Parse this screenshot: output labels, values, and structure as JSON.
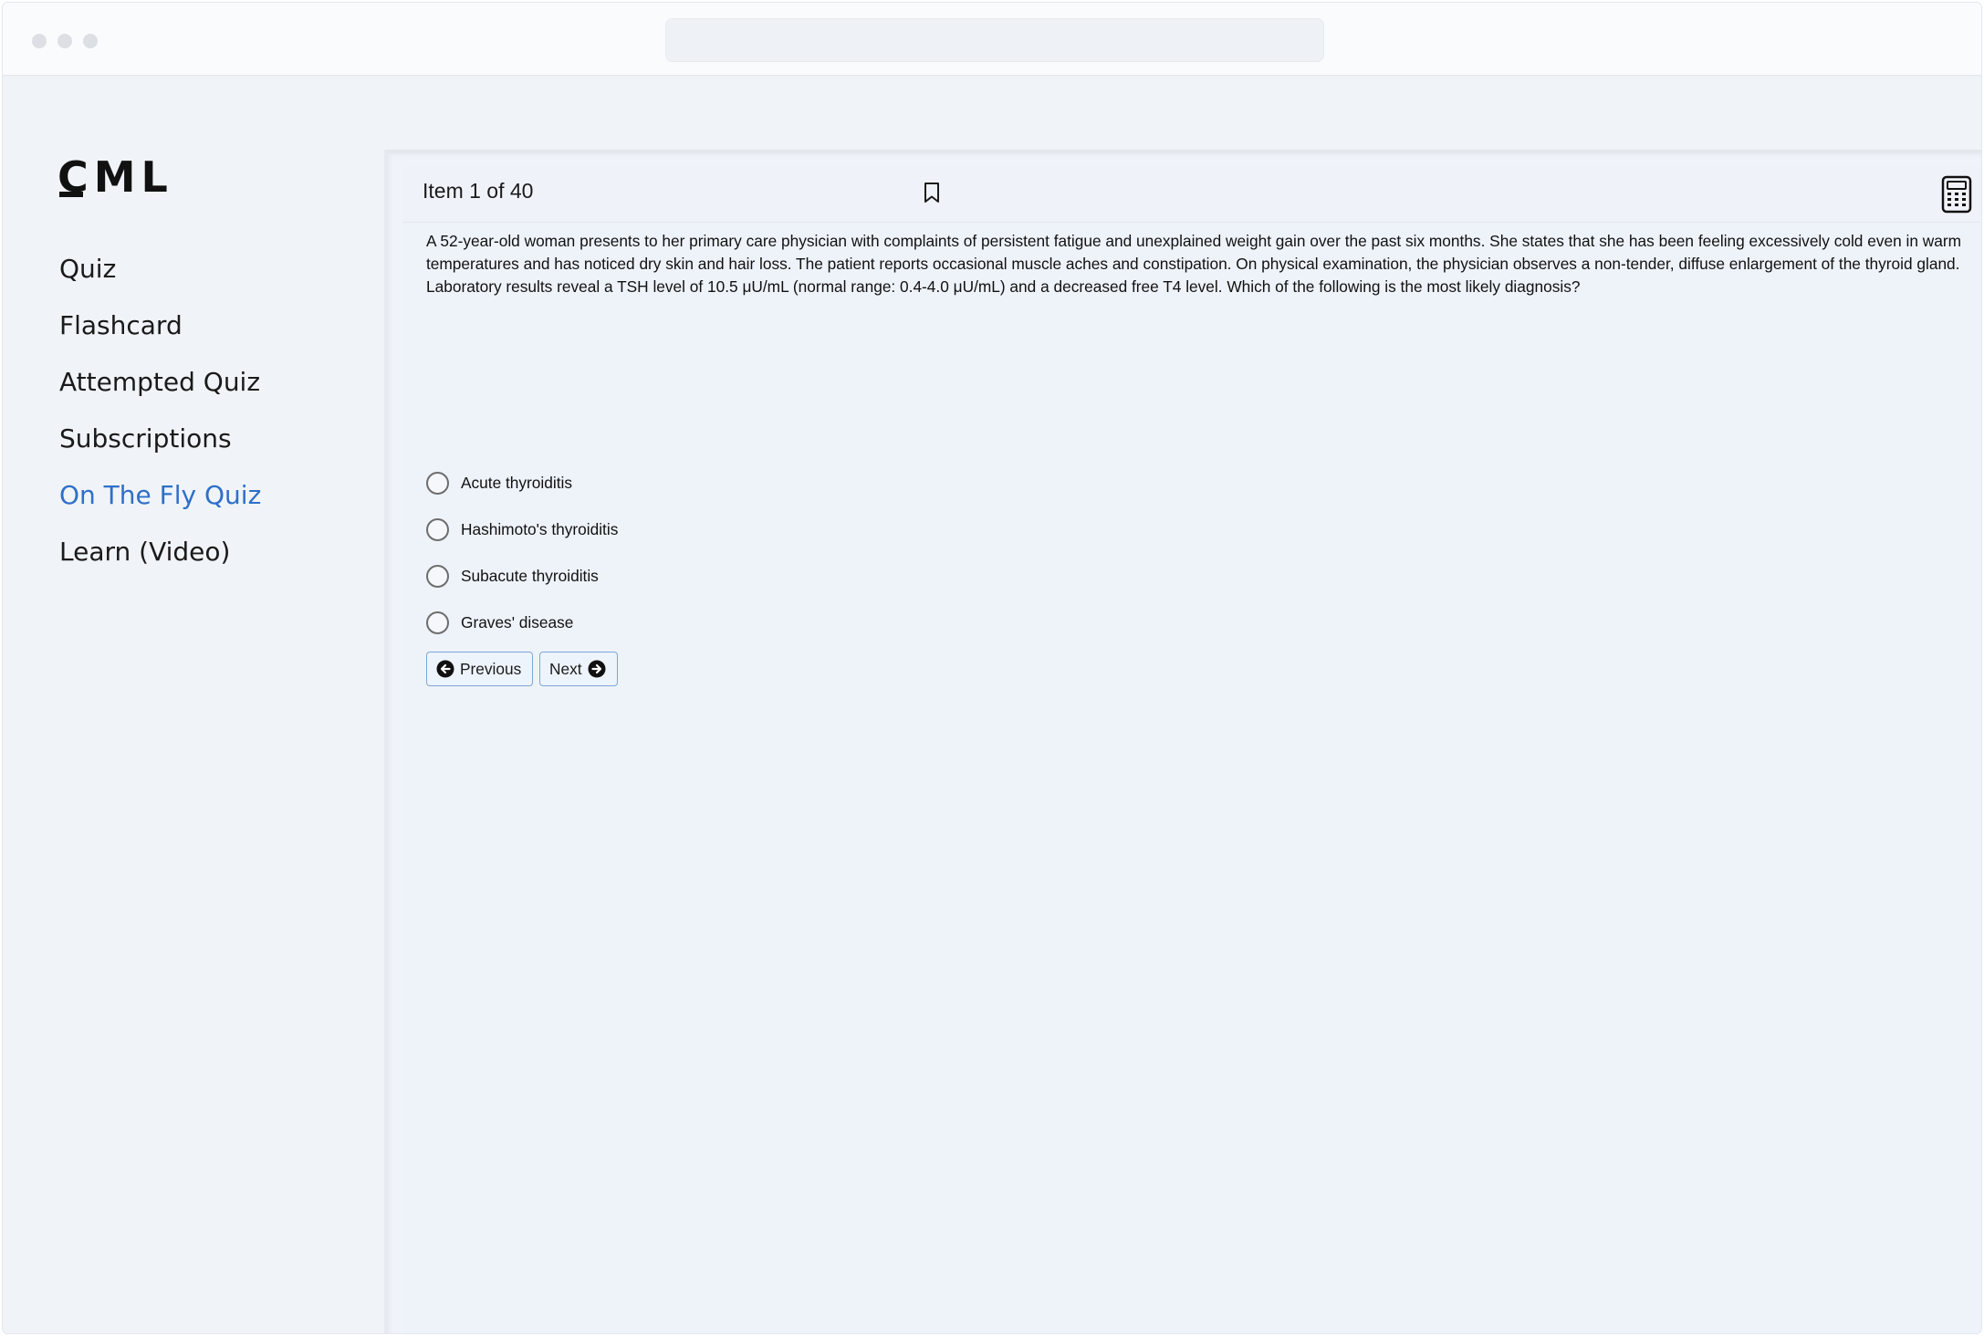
{
  "app": {
    "logo_text": "CML"
  },
  "sidebar": {
    "items": [
      {
        "label": "Quiz",
        "active": false
      },
      {
        "label": "Flashcard",
        "active": false
      },
      {
        "label": "Attempted Quiz",
        "active": false
      },
      {
        "label": "Subscriptions",
        "active": false
      },
      {
        "label": "On The Fly Quiz",
        "active": true
      },
      {
        "label": "Learn (Video)",
        "active": false
      }
    ],
    "active_color": "#2f6fc8"
  },
  "quiz": {
    "item_title": "Item 1 of 40",
    "question": "A 52-year-old woman presents to her primary care physician with complaints of persistent fatigue and unexplained weight gain over the past six months. She states that she has been feeling excessively cold even in warm temperatures and has noticed dry skin and hair loss. The patient reports occasional muscle aches and constipation. On physical examination, the physician observes a non-tender, diffuse enlargement of the thyroid gland. Laboratory results reveal a TSH level of 10.5 μU/mL (normal range: 0.4-4.0 μU/mL) and a decreased free T4 level. Which of the following is the most likely diagnosis?",
    "options": [
      {
        "label": "Acute thyroiditis",
        "selected": false
      },
      {
        "label": "Hashimoto's thyroiditis",
        "selected": false
      },
      {
        "label": "Subacute thyroiditis",
        "selected": false
      },
      {
        "label": "Graves' disease",
        "selected": false
      }
    ],
    "previous_label": "Previous",
    "next_label": "Next"
  },
  "icons": {
    "bookmark": "bookmark-icon",
    "calculator": "calculator-icon",
    "previous": "arrow-circle-left-icon",
    "next": "arrow-circle-right-icon"
  }
}
